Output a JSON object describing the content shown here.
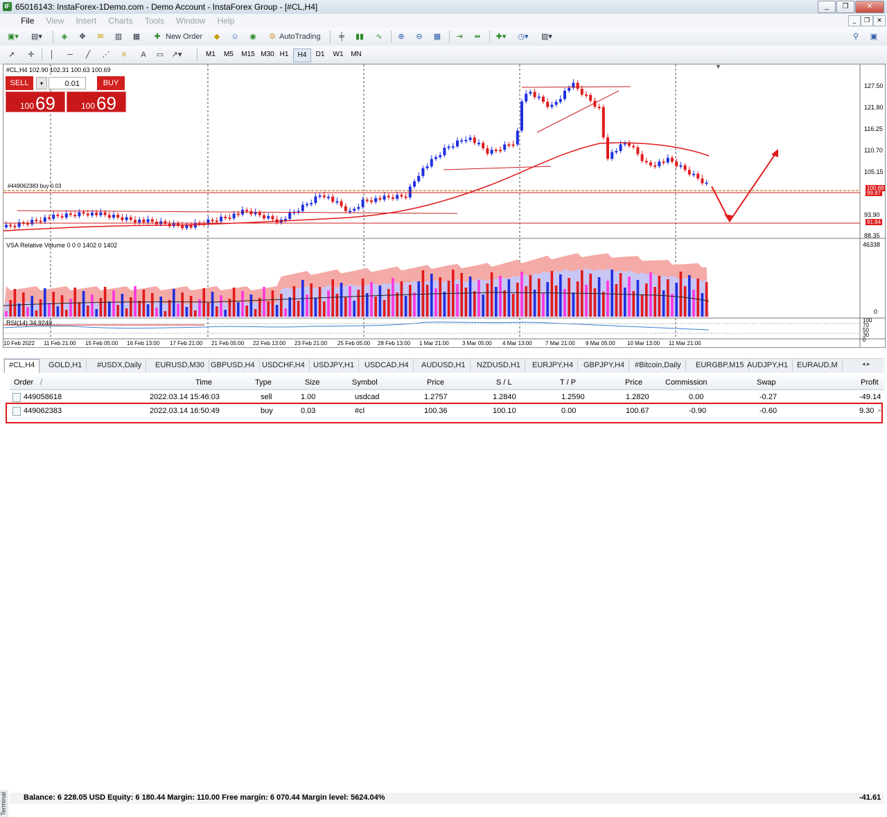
{
  "window": {
    "title": "65016143: InstaForex-1Demo.com - Demo Account - InstaForex Group - [#CL,H4]",
    "app_icon": "instaforex-icon",
    "controls": [
      "_",
      "❐",
      "✕"
    ]
  },
  "menu": [
    "File",
    "View",
    "Insert",
    "Charts",
    "Tools",
    "Window",
    "Help"
  ],
  "toolbar": {
    "new_order": "New Order",
    "autotrading": "AutoTrading",
    "text_tool": "A"
  },
  "timeframes": [
    "M1",
    "M5",
    "M15",
    "M30",
    "H1",
    "H4",
    "D1",
    "W1",
    "MN"
  ],
  "active_timeframe": "H4",
  "chart": {
    "symbol_info": "#CL,H4  102.90 102.31 100.63 100.69",
    "trade_panel": {
      "sell_label": "SELL",
      "buy_label": "BUY",
      "lot": "0.01",
      "sell_small": "100",
      "sell_big": "69",
      "buy_small": "100",
      "buy_big": "69"
    },
    "order_label": "#449062383 buy 0.03",
    "price_labels": [
      "127.50",
      "121.80",
      "116.25",
      "110.70",
      "105.15",
      "93.90",
      "88.35"
    ],
    "current_price_tag": "100.69",
    "order_price_tag": "99.87",
    "level_tag": "91.84",
    "volume_label": "VSA Relative Volume 0 0 0 1402 0 1402",
    "volume_scale": [
      "46338",
      "0"
    ],
    "rsi_label": "RSI(14) 34.9249",
    "rsi_scale": [
      "100",
      "70",
      "50",
      "30",
      "0"
    ],
    "time_labels": [
      "10 Feb 2022",
      "11 Feb 21:00",
      "15 Feb 05:00",
      "16 Feb 13:00",
      "17 Feb 21:00",
      "21 Feb 05:00",
      "22 Feb 13:00",
      "23 Feb 21:00",
      "25 Feb 05:00",
      "28 Feb 13:00",
      "1 Mar 21:00",
      "3 Mar 05:00",
      "4 Mar 13:00",
      "7 Mar 21:00",
      "9 Mar 05:00",
      "10 Mar 13:00",
      "11 Mar 21:00"
    ]
  },
  "tabs": [
    "#CL,H4",
    "GOLD,H1",
    "#USDX,Daily",
    "EURUSD,M30",
    "GBPUSD,H4",
    "USDCHF,H4",
    "USDJPY,H1",
    "USDCAD,H4",
    "AUDUSD,H1",
    "NZDUSD,H1",
    "EURJPY,H4",
    "GBPJPY,H4",
    "#Bitcoin,Daily",
    "EURGBP,M15",
    "AUDJPY,H1",
    "EURAUD,M"
  ],
  "terminal": {
    "headers": {
      "order": "Order",
      "sort": "/",
      "time": "Time",
      "type": "Type",
      "size": "Size",
      "symbol": "Symbol",
      "price": "Price",
      "sl": "S / L",
      "tp": "T / P",
      "price2": "Price",
      "commission": "Commission",
      "swap": "Swap",
      "profit": "Profit"
    },
    "rows": [
      {
        "order": "449058618",
        "time": "2022.03.14 15:46:03",
        "type": "sell",
        "size": "1.00",
        "symbol": "usdcad",
        "price": "1.2757",
        "sl": "1.2840",
        "tp": "1.2590",
        "price2": "1.2820",
        "commission": "0.00",
        "swap": "-0.27",
        "profit": "-49.14"
      },
      {
        "order": "449062383",
        "time": "2022.03.14 16:50:49",
        "type": "buy",
        "size": "0.03",
        "symbol": "#cl",
        "price": "100.36",
        "sl": "100.10",
        "tp": "0.00",
        "price2": "100.67",
        "commission": "-0.90",
        "swap": "-0.60",
        "profit": "9.30"
      }
    ],
    "balance": "Balance: 6 228.05 USD  Equity: 6 180.44  Margin: 110.00  Free margin: 6 070.44  Margin level: 5624.04%",
    "balance_profit": "-41.61",
    "vertical_tab": "Terminal"
  },
  "colors": {
    "bull": "#1f2fe0",
    "bear": "#e11b1b",
    "ma": "#e0191b",
    "highlight": "#e21b1b"
  }
}
